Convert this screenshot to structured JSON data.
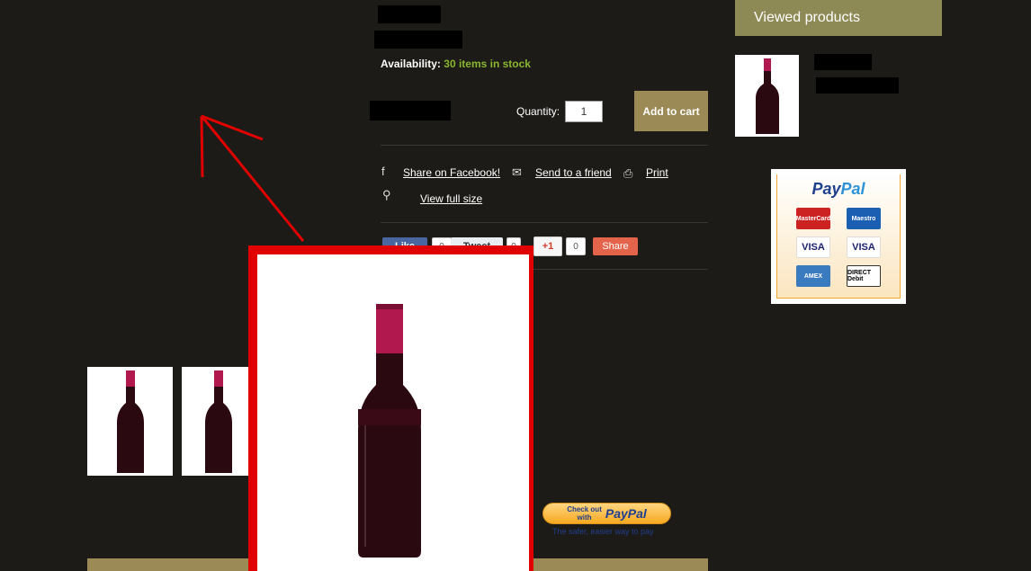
{
  "product": {
    "availability_label": "Availability:",
    "availability_value": "30 items in stock",
    "quantity_label": "Quantity:",
    "quantity_value": "1",
    "add_to_cart": "Add to cart"
  },
  "actions": {
    "share_facebook": "Share on Facebook!",
    "send_friend": "Send to a friend",
    "print": "Print",
    "view_full_size": "View full size"
  },
  "social": {
    "like": "Like",
    "like_count": "0",
    "tweet": "Tweet",
    "tweet_count": "0",
    "gplus": "+1",
    "gplus_count": "0",
    "share": "Share"
  },
  "sidebar": {
    "viewed_header": "Viewed products",
    "paypal_logo_pay": "Pay",
    "paypal_logo_pal": "Pal",
    "cards": [
      "MasterCard",
      "Maestro",
      "VISA",
      "VISA",
      "AMEX",
      "DIRECT Debit"
    ]
  },
  "checkout": {
    "line1": "Check out",
    "line2": "with",
    "brand": "PayPal",
    "tagline": "The safer, easier way to pay"
  },
  "colors": {
    "background": "#1d1b17",
    "accent": "#9c8a56",
    "stock_green": "#8ab530",
    "annotation_red": "#e00000"
  }
}
